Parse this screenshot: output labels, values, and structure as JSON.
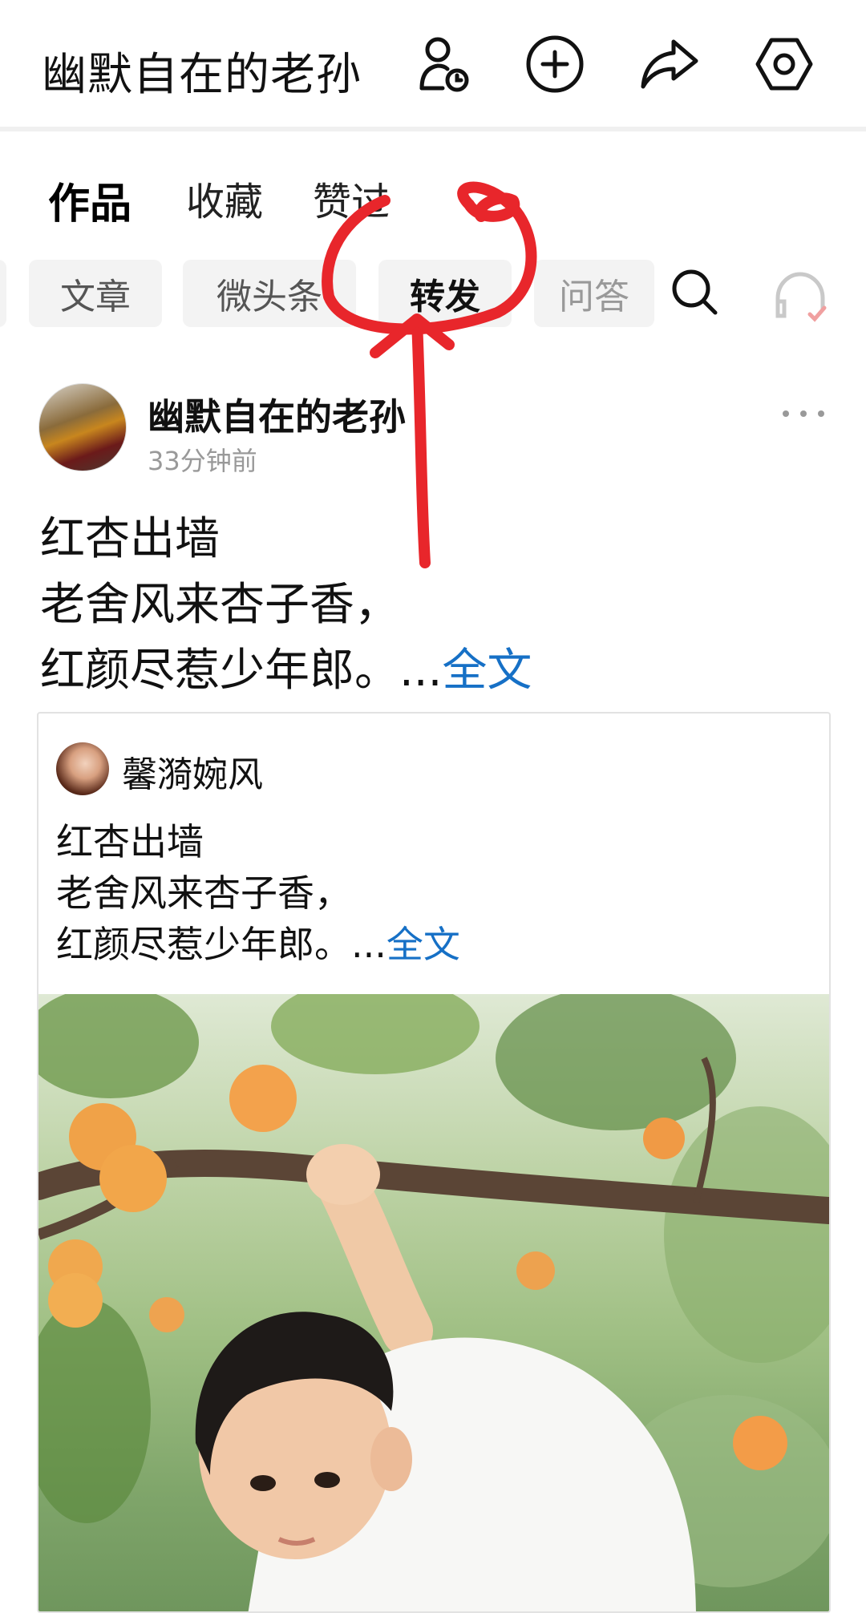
{
  "header": {
    "title": "幽默自在的老孙",
    "icons": [
      "user-clock-icon",
      "add-circle-icon",
      "share-icon",
      "settings-hex-icon"
    ]
  },
  "tabs": [
    {
      "label": "作品",
      "active": true
    },
    {
      "label": "收藏",
      "active": false
    },
    {
      "label": "赞过",
      "active": false
    }
  ],
  "filters": [
    {
      "label": "文章",
      "selected": false
    },
    {
      "label": "微头条",
      "selected": false
    },
    {
      "label": "转发",
      "selected": true
    },
    {
      "label": "问答",
      "selected": false
    }
  ],
  "post": {
    "author": "幽默自在的老孙",
    "time": "33分钟前",
    "lines": [
      "红杏出墙",
      "老舍风来杏子香，",
      "红颜尽惹少年郎。..."
    ],
    "full_text_link": "全文"
  },
  "repost": {
    "author": "馨漪婉风",
    "lines": [
      "红杏出墙",
      "老舍风来杏子香，",
      "红颜尽惹少年郎。..."
    ],
    "full_text_link": "全文"
  },
  "colors": {
    "link": "#1670c6",
    "annotation": "#e8262b",
    "chip_bg": "#f3f3f3"
  }
}
